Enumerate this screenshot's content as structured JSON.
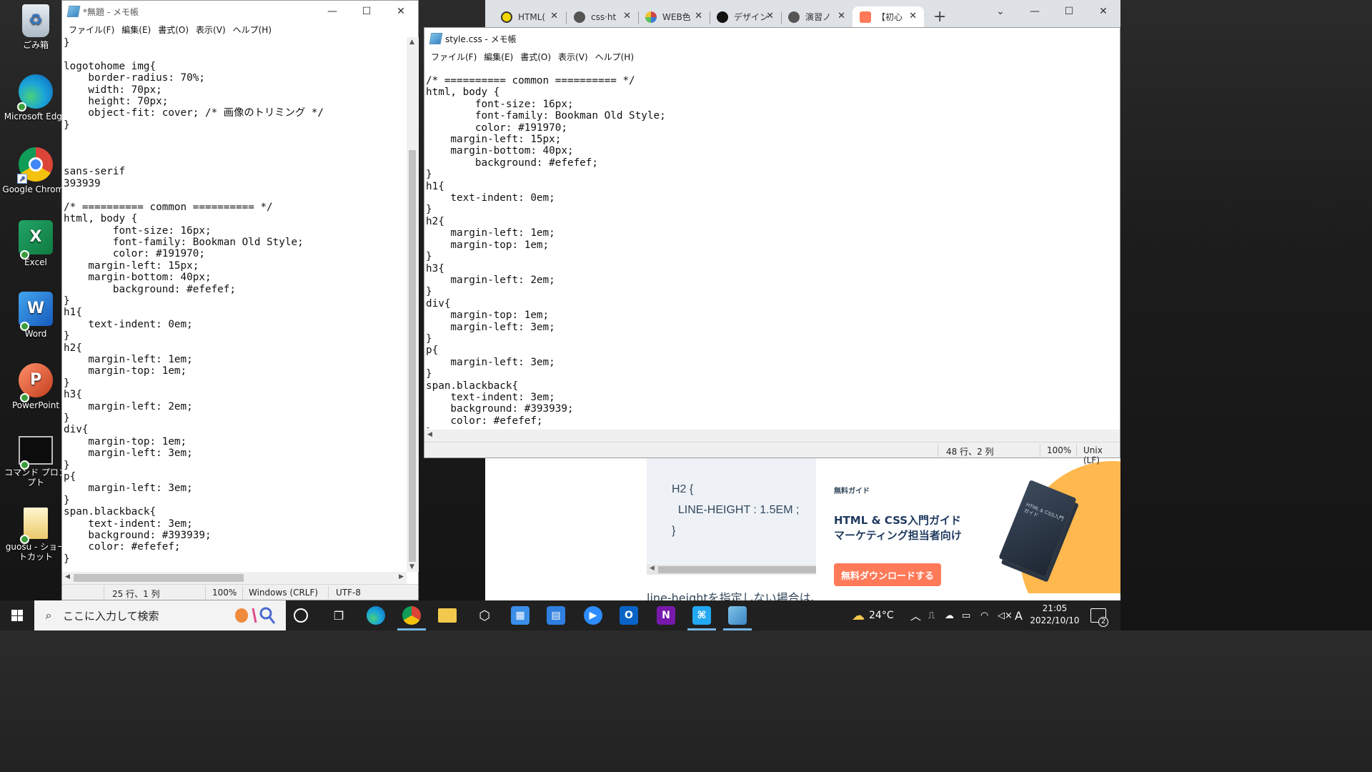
{
  "desktop": {
    "icons": [
      {
        "label": "ごみ箱",
        "icon": "recycle-bin-icon"
      },
      {
        "label": "Microsoft Edge",
        "icon": "edge-icon"
      },
      {
        "label": "Google Chrome",
        "icon": "chrome-icon"
      },
      {
        "label": "Excel",
        "icon": "excel-icon"
      },
      {
        "label": "Word",
        "icon": "word-icon"
      },
      {
        "label": "PowerPoint",
        "icon": "powerpoint-icon"
      },
      {
        "label": "コマンド プロンプト",
        "icon": "command-prompt-icon"
      },
      {
        "label": "guosu - ショートカット",
        "icon": "folder-shortcut-icon"
      }
    ],
    "icon_letters": {
      "excel": "X",
      "word": "W",
      "powerpoint": "P"
    }
  },
  "notepad_left": {
    "title": "*無題 - メモ帳",
    "menu": [
      "ファイル(F)",
      "編集(E)",
      "書式(O)",
      "表示(V)",
      "ヘルプ(H)"
    ],
    "content": "}\n\nlogotohome img{\n    border-radius: 70%;\n    width: 70px;\n    height: 70px;\n    object-fit: cover; /* 画像のトリミング */\n}\n\n\n\nsans-serif\n393939\n\n/* ========== common ========== */\nhtml, body {\n        font-size: 16px;\n        font-family: Bookman Old Style;\n        color: #191970;\n    margin-left: 15px;\n    margin-bottom: 40px;\n        background: #efefef;\n}\nh1{\n    text-indent: 0em;\n}\nh2{\n    margin-left: 1em;\n    margin-top: 1em;\n}\nh3{\n    margin-left: 2em;\n}\ndiv{\n    margin-top: 1em;\n    margin-left: 3em;\n}\np{\n    margin-left: 3em;\n}\nspan.blackback{\n    text-indent: 3em;\n    background: #393939;\n    color: #efefef;\n}",
    "status": {
      "position": "25 行、1 列",
      "zoom": "100%",
      "line_ending": "Windows (CRLF)",
      "encoding": "UTF-8"
    }
  },
  "notepad_right": {
    "title": "style.css - メモ帳",
    "menu": [
      "ファイル(F)",
      "編集(E)",
      "書式(O)",
      "表示(V)",
      "ヘルプ(H)"
    ],
    "content": "/* ========== common ========== */\nhtml, body {\n        font-size: 16px;\n        font-family: Bookman Old Style;\n        color: #191970;\n    margin-left: 15px;\n    margin-bottom: 40px;\n        background: #efefef;\n}\nh1{\n    text-indent: 0em;\n}\nh2{\n    margin-left: 1em;\n    margin-top: 1em;\n}\nh3{\n    margin-left: 2em;\n}\ndiv{\n    margin-top: 1em;\n    margin-left: 3em;\n}\np{\n    margin-left: 3em;\n}\nspan.blackback{\n    text-indent: 3em;\n    background: #393939;\n    color: #efefef;\n}",
    "status": {
      "position": "48 行、2 列",
      "zoom": "100%",
      "line_ending": "Unix (LF)"
    }
  },
  "browser": {
    "tabs": [
      {
        "label": "HTML(",
        "color": "#f2d600"
      },
      {
        "label": "css·ht",
        "color": "#555555"
      },
      {
        "label": "WEB色",
        "color": "#d04545"
      },
      {
        "label": "デザイン",
        "color": "#111111"
      },
      {
        "label": "演習ノ",
        "color": "#555555"
      },
      {
        "label": "【初心",
        "color": "#ff7a59"
      }
    ],
    "page": {
      "code_lines": [
        "H2 {",
        "  LINE-HEIGHT : 1.5EM ;",
        "}"
      ],
      "guide_label": "無料ガイド",
      "guide_title_1": "HTML & CSS入門ガイド",
      "guide_title_2": "マーケティング担当者向け",
      "download_button": "無料ダウンロードする",
      "body_text": "line-heightを指定しない場合は、"
    }
  },
  "taskbar": {
    "search_placeholder": "ここに入力して検索",
    "weather": "24°C",
    "ime": "A",
    "time": "21:05",
    "date": "2022/10/10",
    "notification_count": "2",
    "accent": "#77b7e8"
  }
}
